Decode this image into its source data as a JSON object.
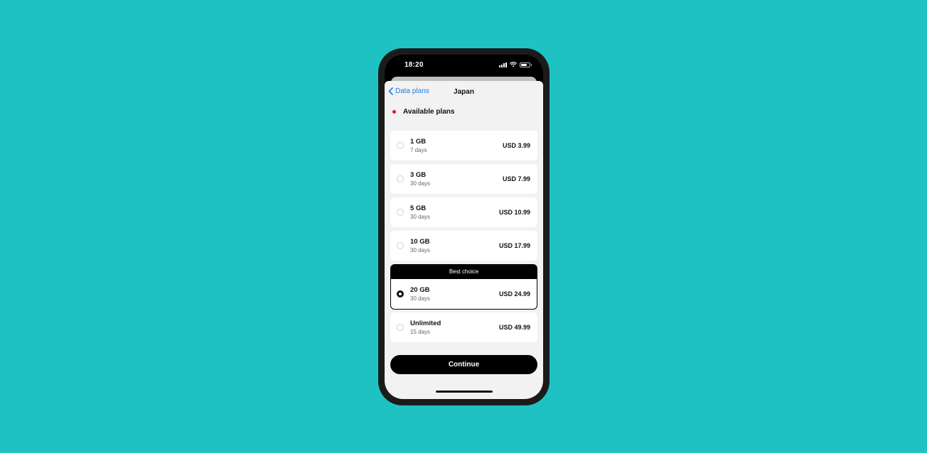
{
  "status_bar": {
    "time": "18:20",
    "icons": [
      "signal-icon",
      "wifi-icon",
      "battery-icon"
    ]
  },
  "nav": {
    "back_label": "Data plans",
    "title": "Japan"
  },
  "section": {
    "title": "Available plans",
    "indicator_color": "#d61b1b"
  },
  "plans": [
    {
      "name": "1 GB",
      "days": "7 days",
      "price": "USD 3.99",
      "selected": false
    },
    {
      "name": "3 GB",
      "days": "30 days",
      "price": "USD 7.99",
      "selected": false
    },
    {
      "name": "5 GB",
      "days": "30 days",
      "price": "USD 10.99",
      "selected": false
    },
    {
      "name": "10 GB",
      "days": "30 days",
      "price": "USD 17.99",
      "selected": false
    }
  ],
  "best_choice": {
    "badge": "Best choice",
    "name": "20 GB",
    "days": "30 days",
    "price": "USD 24.99",
    "selected": true
  },
  "unlimited": {
    "name": "Unlimited",
    "days": "15 days",
    "price": "USD 49.99",
    "selected": false
  },
  "continue_label": "Continue",
  "colors": {
    "background": "#1fc2c2",
    "accent": "#1f7be8",
    "button": "#000000"
  }
}
